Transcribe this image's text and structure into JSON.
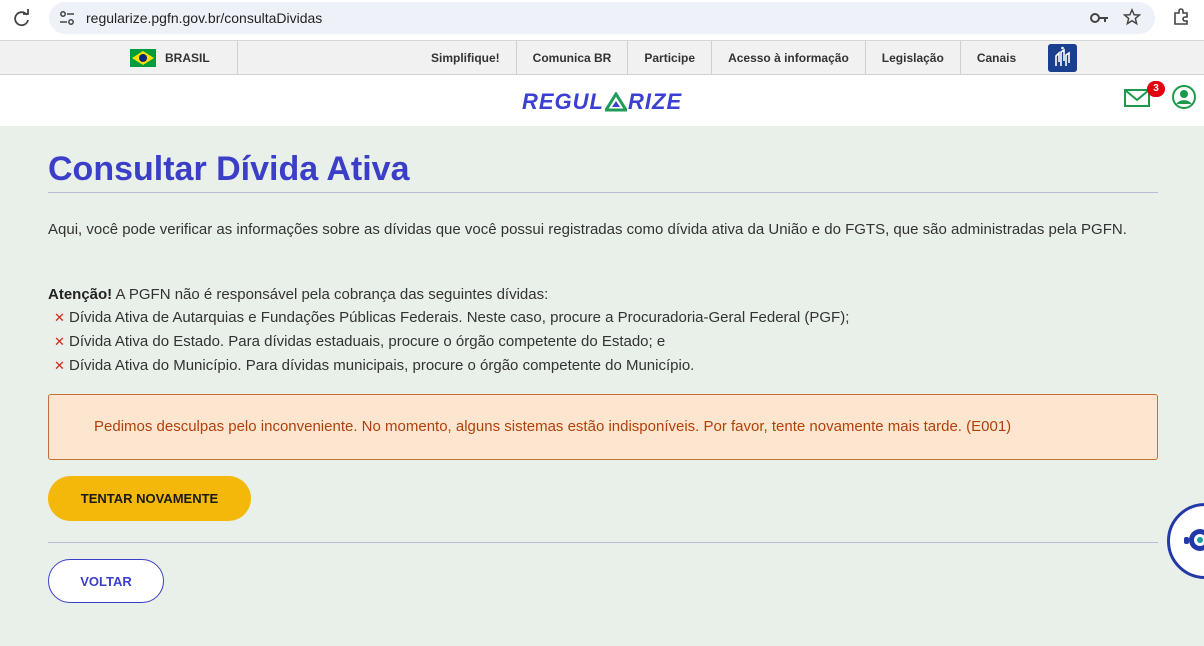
{
  "browser": {
    "url": "regularize.pgfn.gov.br/consultaDividas"
  },
  "gov_bar": {
    "country": "BRASIL",
    "links": [
      "Simplifique!",
      "Comunica BR",
      "Participe",
      "Acesso à informação",
      "Legislação",
      "Canais"
    ]
  },
  "header": {
    "logo_left": "REGUL",
    "logo_right": "RIZE",
    "notification_count": "3"
  },
  "main": {
    "title": "Consultar Dívida Ativa",
    "intro": "Aqui, você pode verificar as informações sobre as dívidas que você possui registradas como dívida ativa da União e do FGTS, que são administradas pela PGFN.",
    "attention_label": "Atenção!",
    "attention_text": " A PGFN não é responsável pela cobrança das seguintes dívidas:",
    "debts": [
      "Dívida Ativa de Autarquias e Fundações Públicas Federais. Neste caso, procure a Procuradoria-Geral Federal (PGF);",
      "Dívida Ativa do Estado. Para dívidas estaduais, procure o órgão competente do Estado; e",
      "Dívida Ativa do Município. Para dívidas municipais, procure o órgão competente do Município."
    ],
    "error_message": "Pedimos desculpas pelo inconveniente. No momento, alguns sistemas estão indisponíveis. Por favor, tente novamente mais tarde. (E001)",
    "retry_label": "TENTAR NOVAMENTE",
    "back_label": "VOLTAR"
  },
  "colors": {
    "primary": "#3b3fc8",
    "accent_button": "#f3b80a",
    "error_bg": "#fde6cf",
    "error_text": "#b2400b",
    "page_bg": "#e9efe9"
  },
  "icons": {
    "reload": "reload-icon",
    "site_info": "site-info-icon",
    "key": "key-icon",
    "star": "star-icon",
    "extensions": "extensions-icon",
    "flag": "brazil-flag-icon",
    "libras": "libras-accessibility-icon",
    "mail": "mail-icon",
    "user": "user-icon",
    "chat": "chat-assistant-icon"
  }
}
